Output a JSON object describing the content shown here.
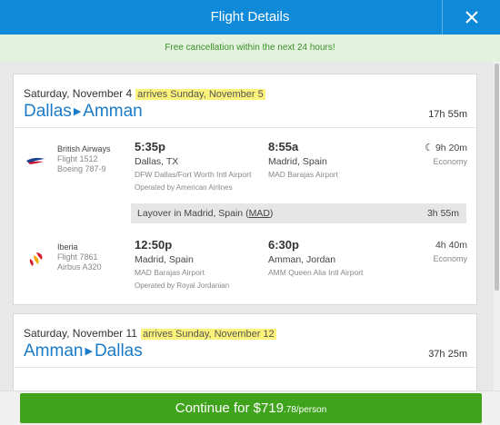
{
  "header": {
    "title": "Flight Details",
    "close_icon": "close-icon"
  },
  "banner": {
    "text": "Free cancellation within the next 24 hours!"
  },
  "trips": [
    {
      "date": "Saturday, November 4",
      "arrives": "arrives Sunday, November 5",
      "origin": "Dallas",
      "destination": "Amman",
      "duration": "17h 55m",
      "segments": [
        {
          "airline": "British Airways",
          "flight": "Flight 1512",
          "aircraft": "Boeing 787-9",
          "dep_time": "5:35p",
          "dep_city": "Dallas, TX",
          "dep_airport": "DFW Dallas/Fort Worth Intl Airport",
          "arr_time": "8:55a",
          "arr_city": "Madrid, Spain",
          "arr_airport": "MAD Barajas Airport",
          "operated_by": "Operated by American Airlines",
          "duration": "9h 20m",
          "cabin": "Economy"
        },
        {
          "airline": "Iberia",
          "flight": "Flight 7861",
          "aircraft": "Airbus A320",
          "dep_time": "12:50p",
          "dep_city": "Madrid, Spain",
          "dep_airport": "MAD Barajas Airport",
          "arr_time": "6:30p",
          "arr_city": "Amman, Jordan",
          "arr_airport": "AMM Queen Alia Intl Airport",
          "operated_by": "Operated by Royal Jordanian",
          "duration": "4h 40m",
          "cabin": "Economy"
        }
      ],
      "layover": {
        "text": "Layover in Madrid, Spain (",
        "code": "MAD",
        "close": ")",
        "duration": "3h 55m"
      }
    },
    {
      "date": "Saturday, November 11",
      "arrives": "arrives Sunday, November 12",
      "origin": "Amman",
      "destination": "Dallas",
      "duration": "37h 25m"
    }
  ],
  "footer": {
    "button_main": "Continue for $719",
    "button_cents": ".78/person"
  },
  "colors": {
    "header": "#0f8ad8",
    "banner_bg": "#e3f2dc",
    "banner_text": "#3a8f2a",
    "link": "#1a7bc9",
    "button": "#3fa31c",
    "highlight": "#fbf27a"
  }
}
